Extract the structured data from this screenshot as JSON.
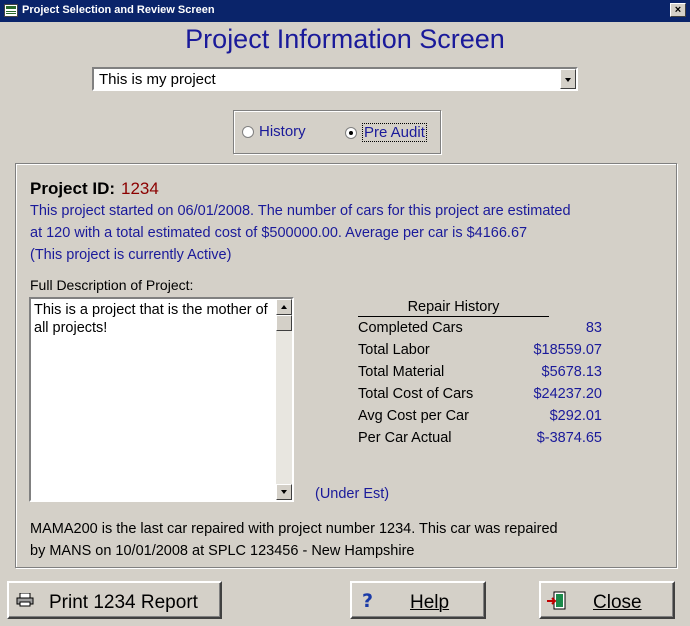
{
  "window": {
    "title": "Project Selection and Review Screen",
    "close_glyph": "×"
  },
  "heading": "Project Information Screen",
  "project_select": {
    "value": "This is my project"
  },
  "mode": {
    "options": [
      {
        "label": "History",
        "selected": false
      },
      {
        "label": "Pre Audit",
        "selected": true
      }
    ]
  },
  "project": {
    "id_label": "Project ID:",
    "id": "1234",
    "summary_lines": [
      "This project started on 06/01/2008.  The number of cars for this project are estimated",
      "at 120 with a total estimated cost of $500000.00.  Average per car is $4166.67",
      "(This project is currently Active)"
    ]
  },
  "description": {
    "label": "Full Description of Project:",
    "text": "This is a project that is the mother of all projects!"
  },
  "repair_history": {
    "title": "Repair History",
    "rows": [
      {
        "label": "Completed Cars",
        "value": "83"
      },
      {
        "label": "Total Labor",
        "value": "$18559.07"
      },
      {
        "label": "Total Material",
        "value": "$5678.13"
      },
      {
        "label": "Total Cost of Cars",
        "value": "$24237.20"
      },
      {
        "label": "Avg Cost per Car",
        "value": "$292.01"
      },
      {
        "label": "Per Car Actual",
        "value": "$-3874.65"
      }
    ],
    "status_note": "(Under Est)"
  },
  "last_repair": {
    "lines": [
      "MAMA200 is the last car repaired with project number 1234.  This car was repaired",
      "by MANS on 10/01/2008 at SPLC 123456 - New Hampshire"
    ]
  },
  "buttons": {
    "print": "Print 1234 Report",
    "help": "Help",
    "help_glyph": "?",
    "close": "Close"
  },
  "colors": {
    "accent_text": "#1a1a9a",
    "id_value": "#8b0000",
    "titlebar": "#0a246a"
  }
}
